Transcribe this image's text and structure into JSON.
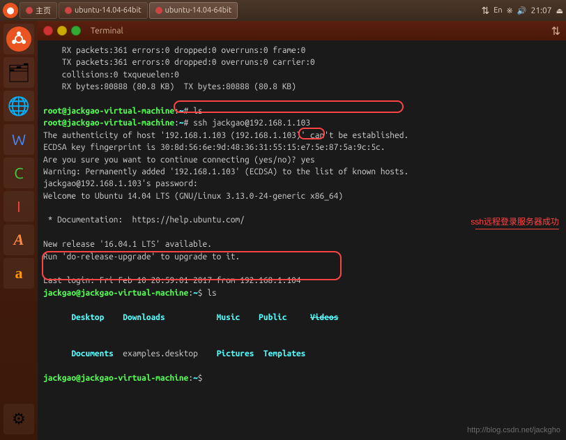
{
  "taskbar": {
    "home_label": "主页",
    "tab1_label": "ubuntu-14.04-64bit",
    "tab2_label": "ubuntu-14.04-64bit",
    "time": "21:07",
    "lang": "En"
  },
  "window": {
    "title": "Terminal",
    "sort_icon": "⇅"
  },
  "terminal": {
    "lines": [
      "    RX packets:361 errors:0 dropped:0 overruns:0 frame:0",
      "    TX packets:361 errors:0 dropped:0 overruns:0 carrier:0",
      "    collisions:0 txqueuelen:0",
      "    RX bytes:80888 (80.8 KB)  TX bytes:80888 (80.8 KB)",
      "",
      "root@jackgao-virtual-machine:~# ls",
      "root@jackgao-virtual-machine:~# ssh jackgao@192.168.1.103",
      "The authenticity of host '192.168.1.103 (192.168.1.103)' can't be established.",
      "ECDSA key fingerprint is 30:8d:56:6e:9d:48:36:31:55:15:e7:5e:87:5a:9c:5c.",
      "Are you sure you want to continue connecting (yes/no)? yes",
      "Warning: Permanently added '192.168.1.103' (ECDSA) to the list of known hosts.",
      "jackgao@192.168.1.103's password:",
      "Welcome to Ubuntu 14.04 LTS (GNU/Linux 3.13.0-24-generic x86_64)",
      "",
      " * Documentation:  https://help.ubuntu.com/",
      "",
      "New release '16.04.1 LTS' available.",
      "Run 'do-release-upgrade' to upgrade to it.",
      "",
      "Last login: Fri Feb 10 20:59:01 2017 from 192.168.1.104",
      "jackgao@jackgao-virtual-machine:~$ ls",
      "Desktop    Downloads           Music    Public     Videos",
      "Documents  examples.desktop    Pictures  Templates",
      "jackgao@jackgao-virtual-machine:~$ "
    ],
    "annotation": "ssh远程登录服务器成功"
  },
  "sidebar": {
    "items": [
      {
        "name": "ubuntu-home",
        "icon": "🔴"
      },
      {
        "name": "files",
        "icon": "📁"
      },
      {
        "name": "firefox",
        "icon": "🦊"
      },
      {
        "name": "libreoffice-writer",
        "icon": "📝"
      },
      {
        "name": "libreoffice-calc",
        "icon": "📊"
      },
      {
        "name": "libreoffice-impress",
        "icon": "📋"
      },
      {
        "name": "font-manager",
        "icon": "A"
      },
      {
        "name": "amazon",
        "icon": "a"
      },
      {
        "name": "settings",
        "icon": "⚙"
      }
    ]
  },
  "watermark": "http://blog.csdn.net/jackgho"
}
